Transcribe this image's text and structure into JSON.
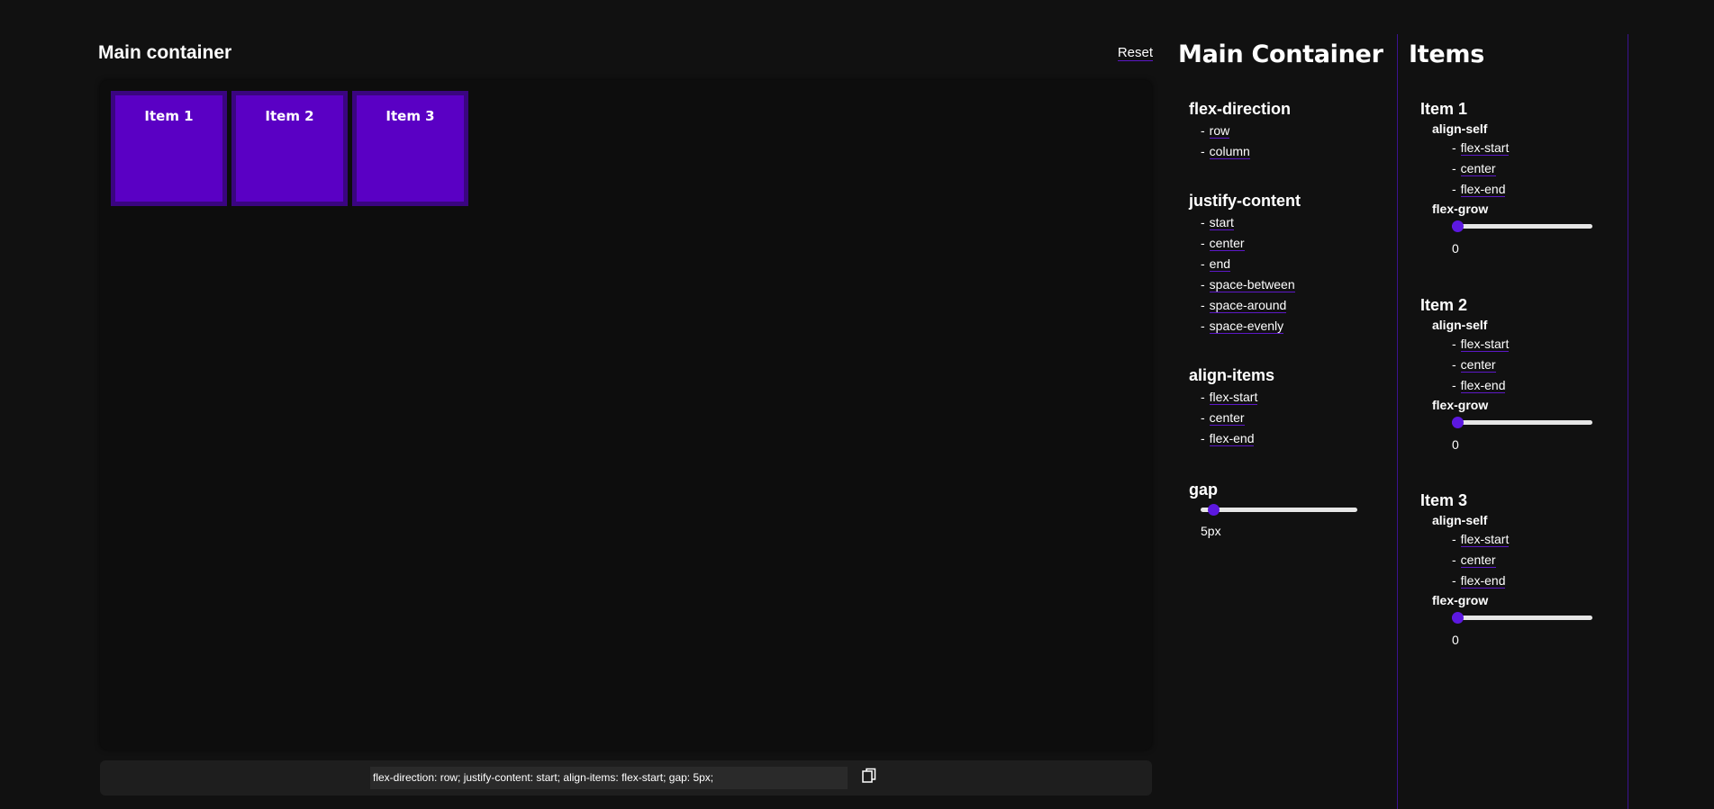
{
  "main": {
    "title": "Main container",
    "reset_label": "Reset",
    "items": [
      "Item 1",
      "Item 2",
      "Item 3"
    ],
    "css_output": "flex-direction: row; justify-content: start; align-items: flex-start; gap: 5px;"
  },
  "container_panel": {
    "title": "Main Container",
    "flex_direction": {
      "label": "flex-direction",
      "options": [
        "row",
        "column"
      ]
    },
    "justify_content": {
      "label": "justify-content",
      "options": [
        "start",
        "center",
        "end",
        "space-between",
        "space-around",
        "space-evenly"
      ]
    },
    "align_items": {
      "label": "align-items",
      "options": [
        "flex-start",
        "center",
        "flex-end"
      ]
    },
    "gap": {
      "label": "gap",
      "value": 5,
      "display": "5px"
    }
  },
  "items_panel": {
    "title": "Items",
    "items": [
      {
        "label": "Item 1",
        "align_self_label": "align-self",
        "align_self_options": [
          "flex-start",
          "center",
          "flex-end"
        ],
        "flex_grow_label": "flex-grow",
        "flex_grow": 0,
        "flex_grow_display": "0"
      },
      {
        "label": "Item 2",
        "align_self_label": "align-self",
        "align_self_options": [
          "flex-start",
          "center",
          "flex-end"
        ],
        "flex_grow_label": "flex-grow",
        "flex_grow": 0,
        "flex_grow_display": "0"
      },
      {
        "label": "Item 3",
        "align_self_label": "align-self",
        "align_self_options": [
          "flex-start",
          "center",
          "flex-end"
        ],
        "flex_grow_label": "flex-grow",
        "flex_grow": 0,
        "flex_grow_display": "0"
      }
    ]
  },
  "colors": {
    "background": "#111111",
    "item_fill": "#5a00c4",
    "item_border": "#3a0580",
    "accent": "#5c18e0"
  }
}
